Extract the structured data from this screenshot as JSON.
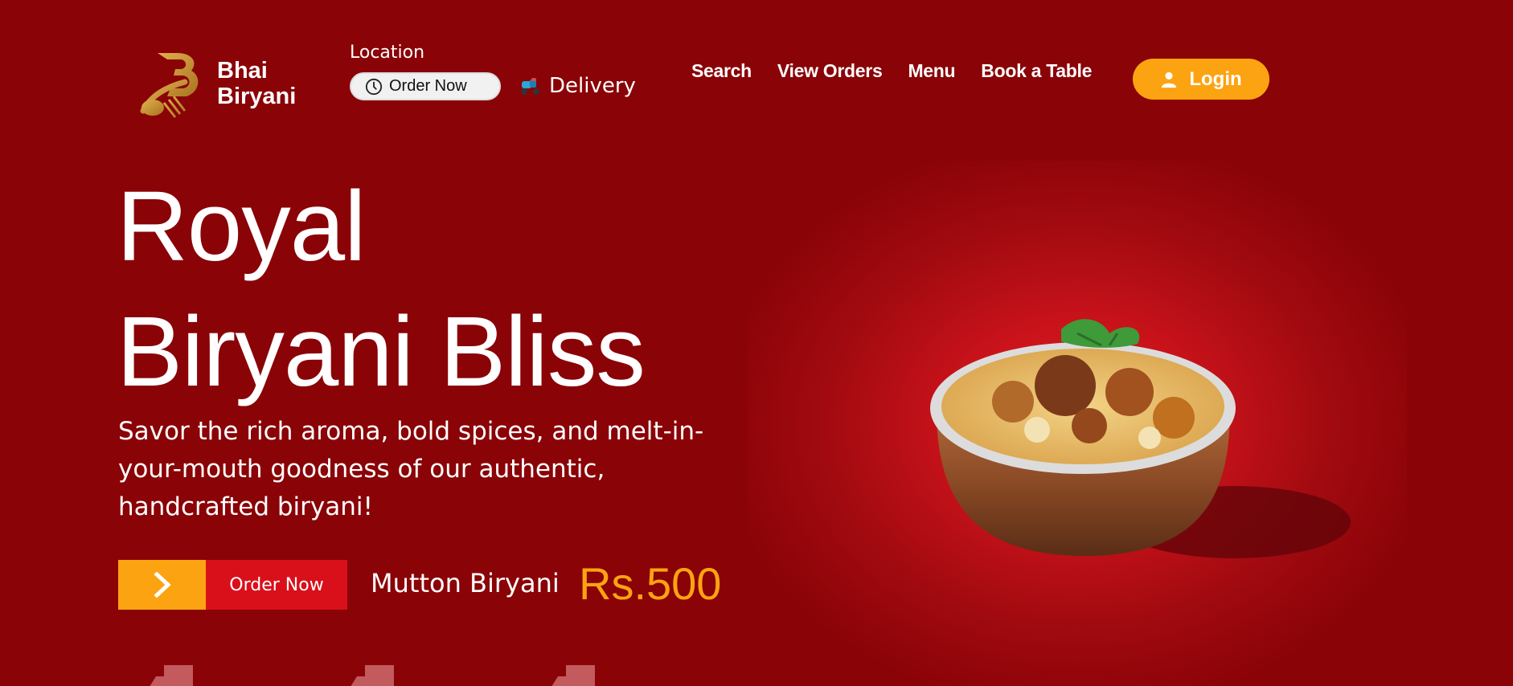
{
  "brand": {
    "line1": "Bhai",
    "line2": "Biryani"
  },
  "location": {
    "label": "Location",
    "order_now": "Order Now"
  },
  "delivery": {
    "label": "Delivery"
  },
  "nav": {
    "items": [
      "Search",
      "View Orders",
      "Menu",
      "Book a Table"
    ]
  },
  "login": {
    "label": "Login"
  },
  "hero": {
    "title_line1": "Royal",
    "title_line2": "Biryani Bliss",
    "description": "Savor the rich aroma, bold spices, and melt-in-your-mouth goodness of our authentic, handcrafted biryani!",
    "cta_label": "Order Now",
    "dish_name": "Mutton Biryani",
    "dish_price": "Rs.500"
  },
  "icons": {
    "logo": "bb-fork-logo",
    "clock": "clock-icon",
    "scooter": "scooter-icon",
    "user": "user-icon",
    "arrow": "chevron-right-icon",
    "category": "category-icon"
  },
  "colors": {
    "background": "#8a0307",
    "accent": "#fca311",
    "cta_red": "#d9101a",
    "logo_gold": "#c98f2b"
  }
}
